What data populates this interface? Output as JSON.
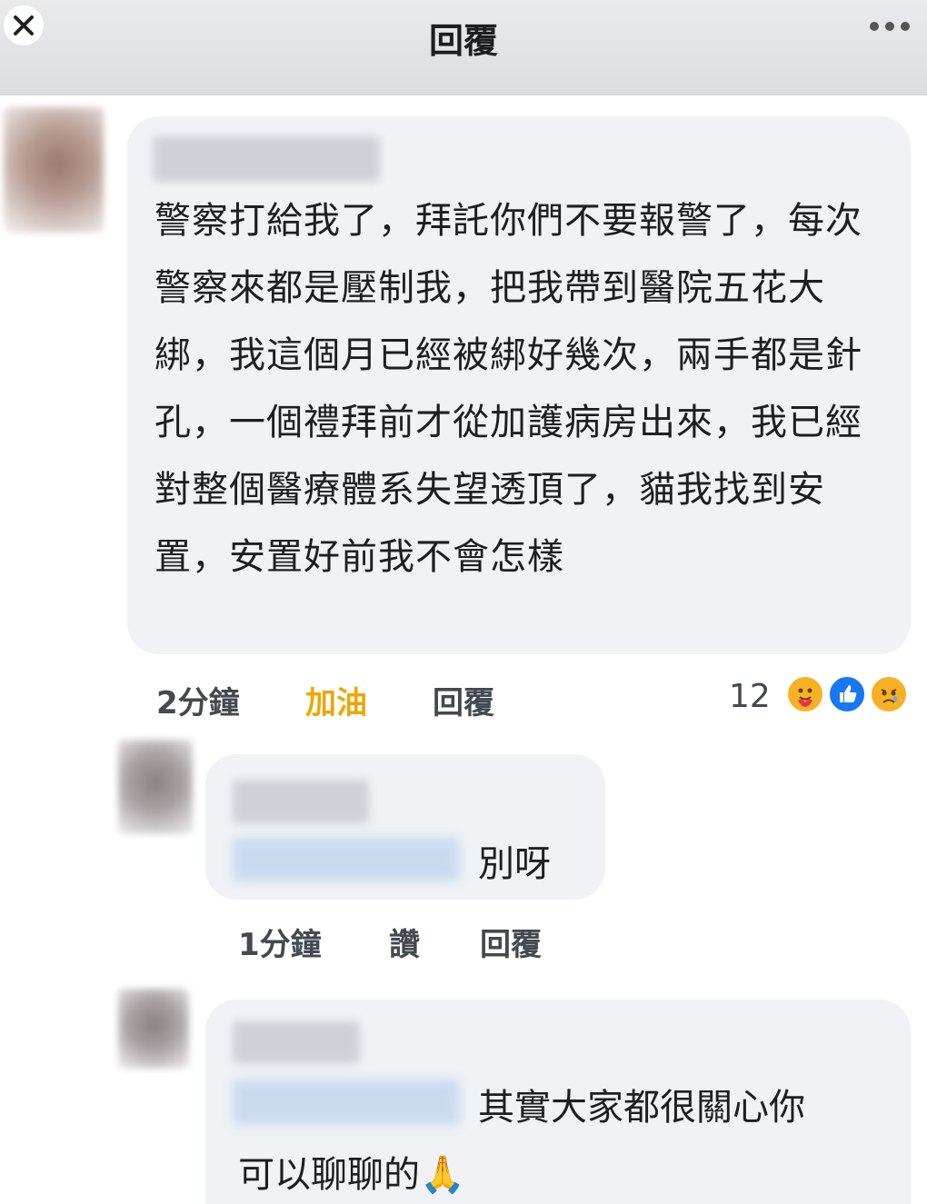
{
  "header": {
    "title": "回覆",
    "close_icon": "close-icon",
    "more_icon": "more-horizontal-icon"
  },
  "main_comment": {
    "text": "警察打給我了，拜託你們不要報警了，每次警察來都是壓制我，把我帶到醫院五花大綁，我這個月已經被綁好幾次，兩手都是針孔，一個禮拜前才從加護病房出來，我已經對整個醫療體系失望透頂了，貓我找到安置，安置好前我不會怎樣",
    "time": "2分鐘",
    "reaction_label": "加油",
    "reply_label": "回覆",
    "reaction_count": "12",
    "reactions": [
      "care-reaction-icon",
      "like-reaction-icon",
      "sad-reaction-icon"
    ]
  },
  "reply_1": {
    "text": "別呀",
    "time": "1分鐘",
    "like_label": "讚",
    "reply_label": "回覆"
  },
  "reply_2": {
    "text_line1": "其實大家都很關心你",
    "text_line2": "可以聊聊的",
    "emoji": "🙏"
  },
  "colors": {
    "bubble": "#f0f2f5",
    "cheer": "#f0a500",
    "meta": "#444950",
    "text": "#1c1e21"
  }
}
